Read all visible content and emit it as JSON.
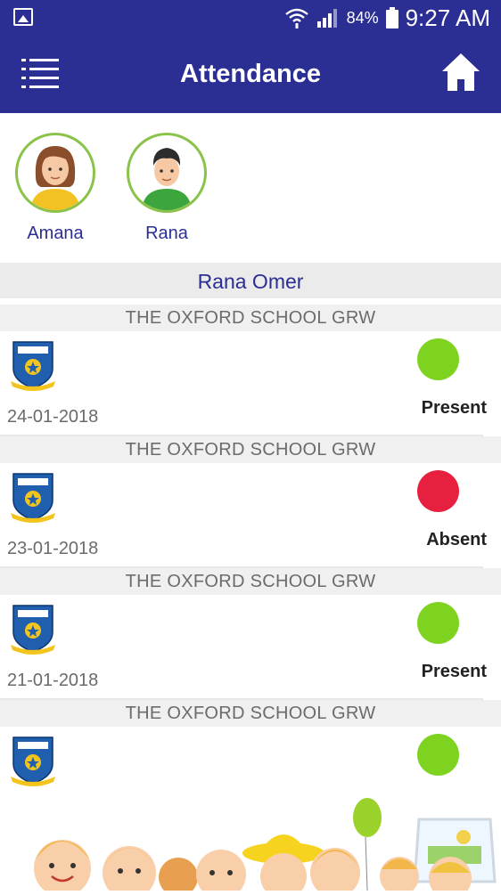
{
  "status_bar": {
    "battery_percent": "84%",
    "time": "9:27 AM",
    "icons": [
      "image-icon",
      "wifi-icon",
      "signal-icon",
      "battery-icon"
    ]
  },
  "app_bar": {
    "title": "Attendance",
    "menu_icon": "menu-icon",
    "home_icon": "home-icon"
  },
  "children": [
    {
      "name": "Amana",
      "avatar": "girl-avatar-icon"
    },
    {
      "name": "Rana",
      "avatar": "boy-avatar-icon"
    }
  ],
  "selected_student": "Rana Omer",
  "records": [
    {
      "school": "THE OXFORD SCHOOL GRW",
      "date": "24-01-2018",
      "status": "Present",
      "color": "#7ed321"
    },
    {
      "school": "THE OXFORD SCHOOL GRW",
      "date": "23-01-2018",
      "status": "Absent",
      "color": "#e8203f"
    },
    {
      "school": "THE OXFORD SCHOOL GRW",
      "date": "21-01-2018",
      "status": "Present",
      "color": "#7ed321"
    },
    {
      "school": "THE OXFORD SCHOOL GRW",
      "date": "",
      "status": "",
      "color": "#7ed321"
    }
  ],
  "theme": {
    "primary": "#2b2f93",
    "present": "#7ed321",
    "absent": "#e8203f",
    "avatar_ring": "#8bc34a"
  }
}
